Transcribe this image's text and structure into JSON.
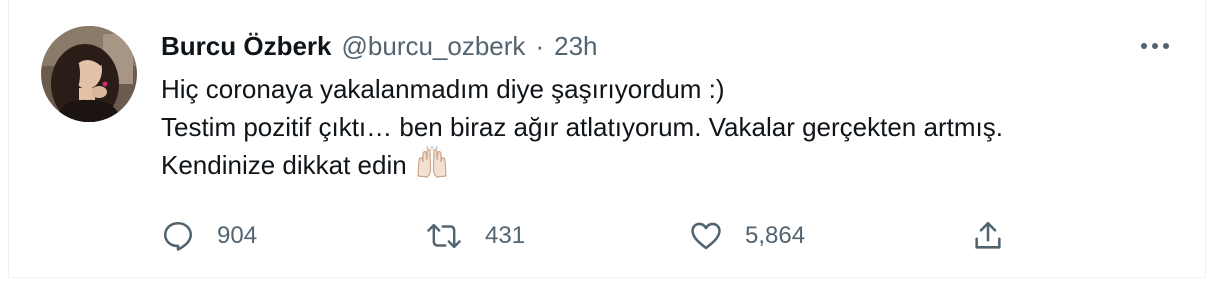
{
  "tweet": {
    "author": {
      "display_name": "Burcu Özberk",
      "handle": "@burcu_ozberk"
    },
    "separator": "·",
    "timestamp": "23h",
    "text_lines": [
      "Hiç coronaya yakalanmadım diye şaşırıyordum :)",
      "Testim pozitif çıktı… ben biraz ağır atlatıyorum. Vakalar gerçekten artmış.",
      "Kendinize dikkat edin"
    ],
    "emoji": "raising-hands-icon",
    "stats": {
      "replies": "904",
      "retweets": "431",
      "likes": "5,864"
    },
    "icons": {
      "reply": "reply-icon",
      "retweet": "retweet-icon",
      "like": "heart-icon",
      "share": "share-icon",
      "more": "more-options-icon"
    },
    "colors": {
      "text_primary": "#0f1419",
      "text_secondary": "#536471",
      "border": "#eff3f4"
    }
  }
}
